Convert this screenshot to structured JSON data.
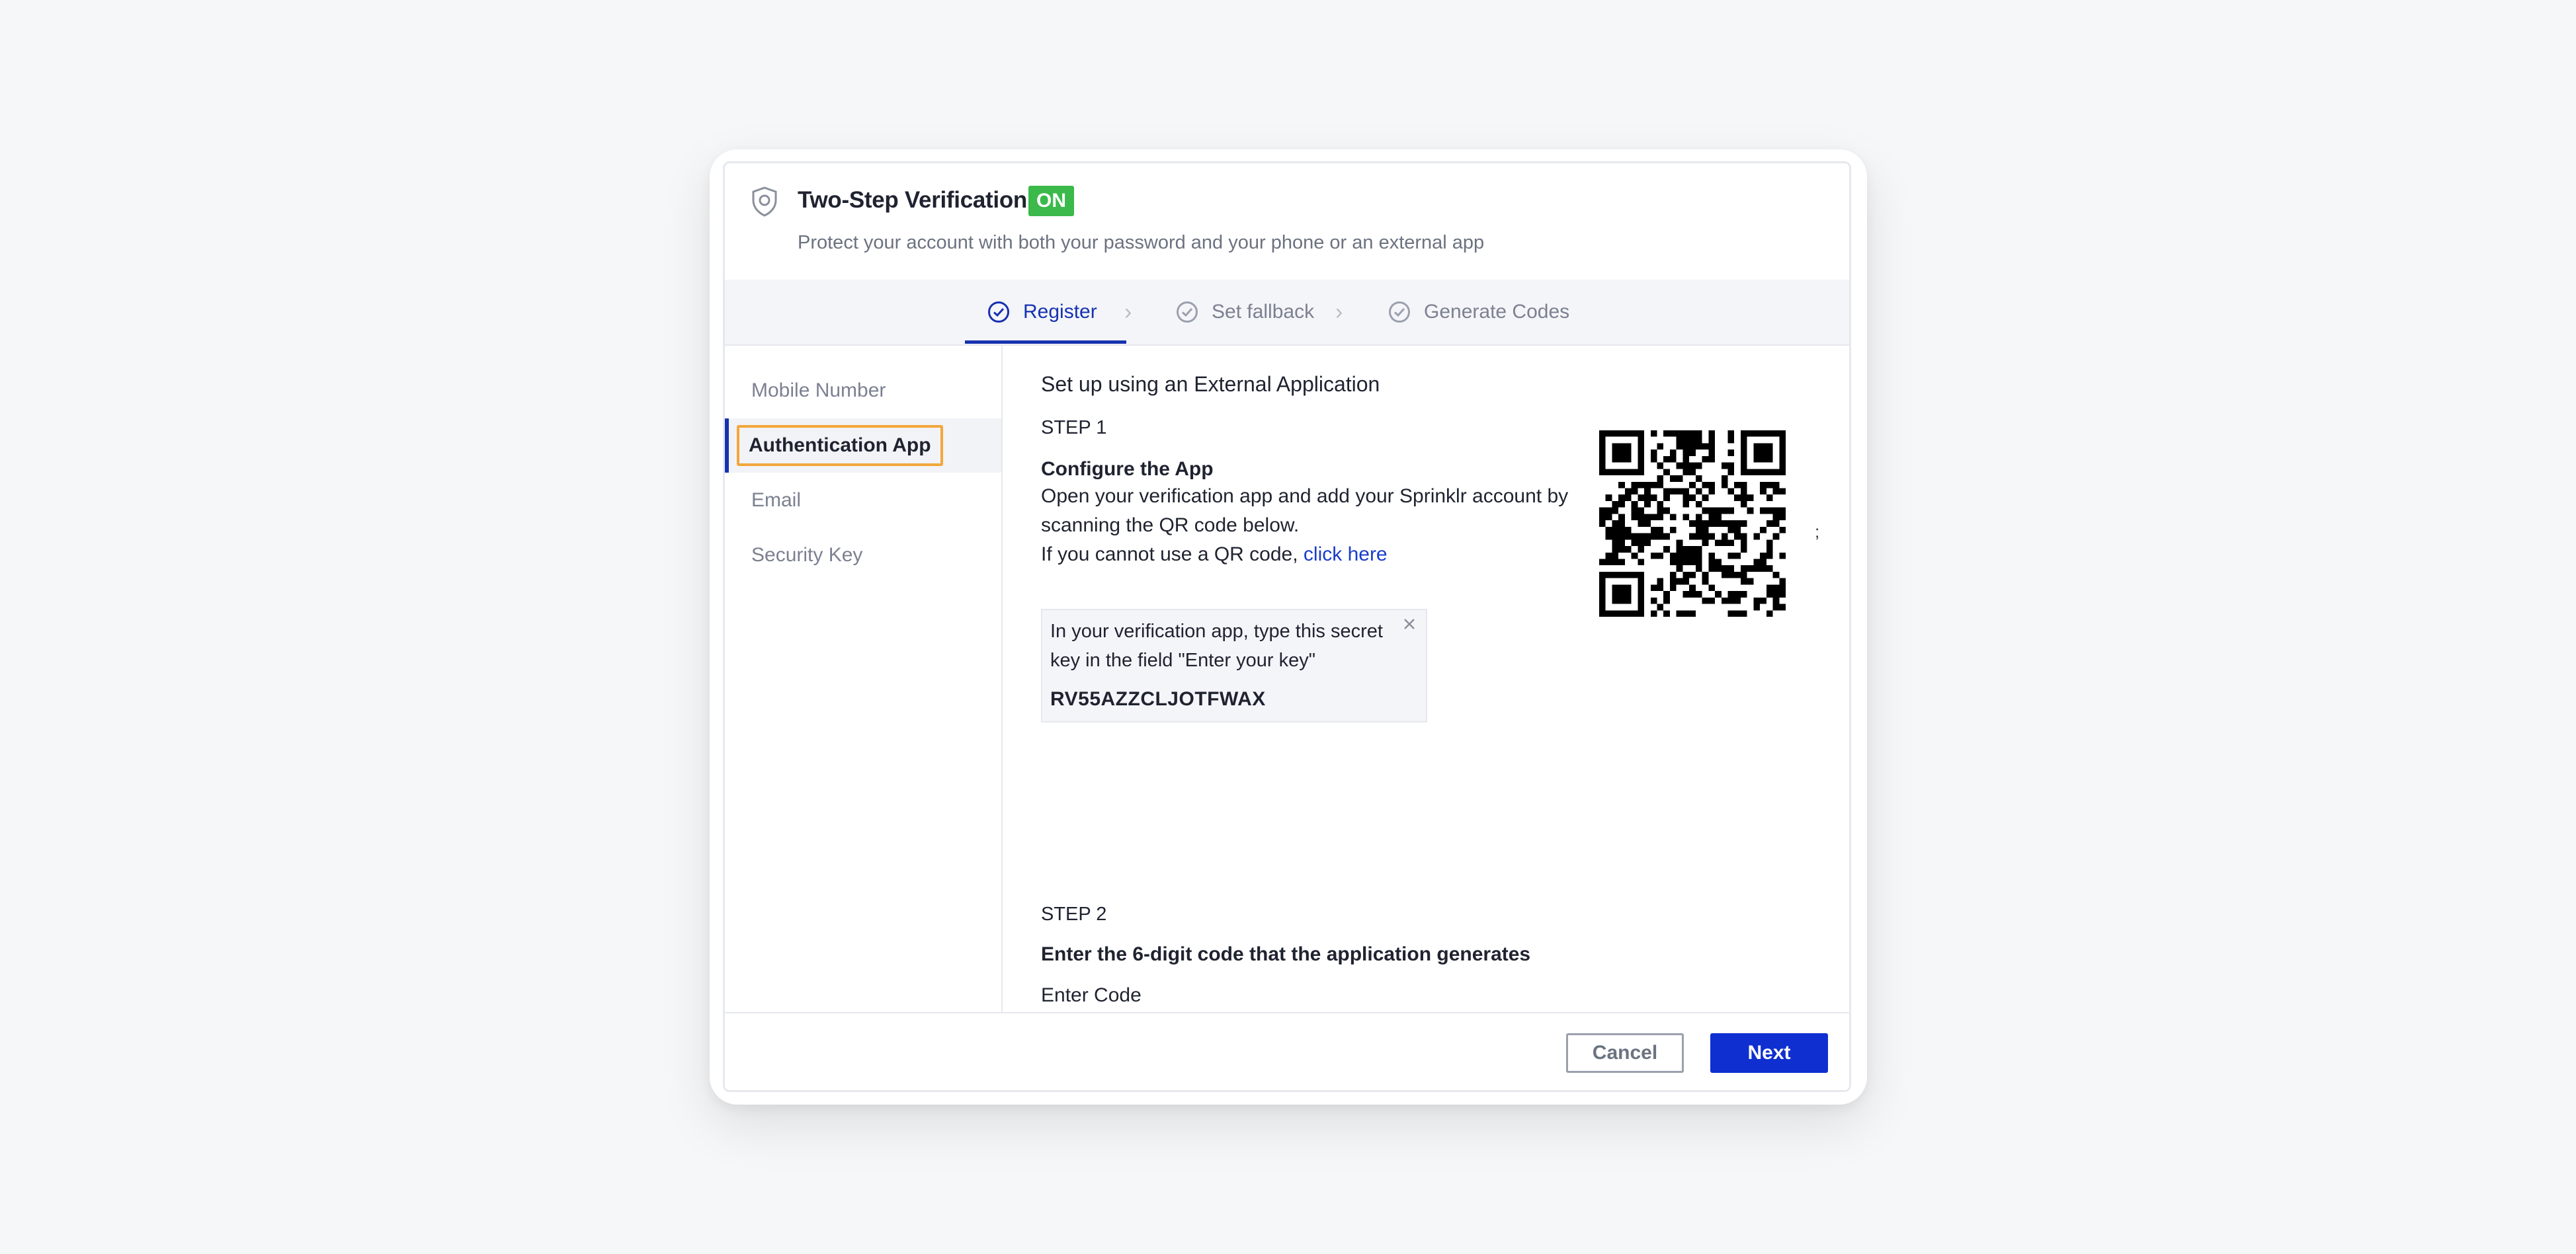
{
  "header": {
    "title": "Two-Step Verification",
    "badge": "ON",
    "subtitle": "Protect your account with both your password and your phone or an external app"
  },
  "stepper": {
    "steps": [
      {
        "label": "Register",
        "active": true
      },
      {
        "label": "Set fallback",
        "active": false
      },
      {
        "label": "Generate Codes",
        "active": false
      }
    ]
  },
  "sidebar": {
    "items": [
      {
        "label": "Mobile Number"
      },
      {
        "label": "Authentication App"
      },
      {
        "label": "Email"
      },
      {
        "label": "Security Key"
      }
    ]
  },
  "main": {
    "section_title": "Set up using an External Application",
    "step1_label": "STEP 1",
    "step1_heading": "Configure the App",
    "step1_text": "Open your verification app and add your Sprinklr account by scanning the QR code below.",
    "qr_fallback_text": "If you cannot use a QR code, ",
    "qr_fallback_link": "click here",
    "secret_instructions": "In your verification app, type this secret key in the field \"Enter your key\"",
    "secret_key": "RV55AZZCLJOTFWAX",
    "stray_mark": ";",
    "step2_label": "STEP 2",
    "step2_heading": "Enter the 6-digit code that the application generates",
    "code_label": "Enter Code"
  },
  "footer": {
    "cancel_label": "Cancel",
    "next_label": "Next"
  },
  "colors": {
    "accent": "#1732b0",
    "primary_button": "#0f2fd0",
    "badge_green": "#3bb94a",
    "highlight_outline": "#f2a73b",
    "background": "#f6f7f9"
  },
  "icons": [
    "shield-icon",
    "check-circle-icon",
    "chevron-right-icon",
    "close-icon",
    "qr-code-icon"
  ]
}
